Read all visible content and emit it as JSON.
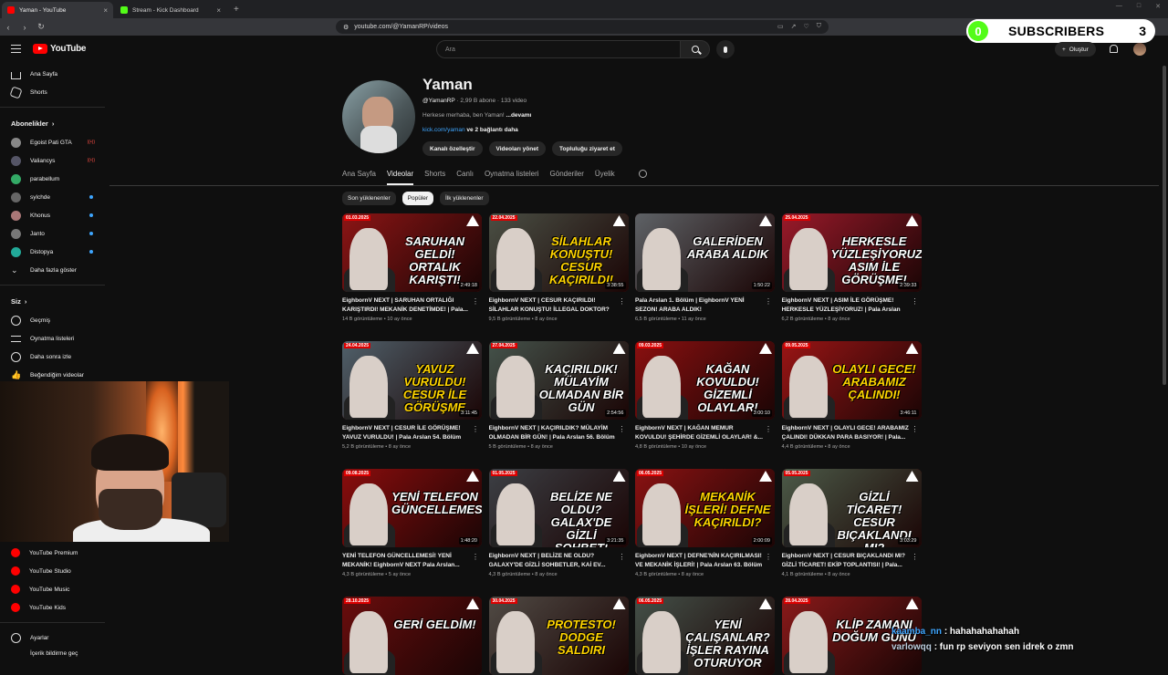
{
  "browser": {
    "tabs": [
      {
        "label": "Yaman - YouTube",
        "color": "#ff0000",
        "active": true
      },
      {
        "label": "Stream - Kick Dashboard",
        "color": "#53fc18",
        "active": false
      }
    ],
    "url": "youtube.com/@YamanRP/videos"
  },
  "youtube": {
    "logo": "YouTube",
    "search_placeholder": "Ara",
    "create_label": "Oluştur"
  },
  "overlay": {
    "left_count": "0",
    "label": "SUBSCRIBERS",
    "right_count": "3"
  },
  "sidebar": {
    "top": [
      {
        "label": "Ana Sayfa",
        "icon": "home-icon"
      },
      {
        "label": "Shorts",
        "icon": "shorts-icon"
      }
    ],
    "subs_header": "Abonelikler",
    "subs": [
      {
        "label": "Egoist Pati GTA",
        "color": "#888",
        "badge": "live"
      },
      {
        "label": "Valiancys",
        "color": "#556",
        "badge": "live"
      },
      {
        "label": "parabellum",
        "color": "#3a6",
        "badge": ""
      },
      {
        "label": "sylchde",
        "color": "#666",
        "badge": "dot"
      },
      {
        "label": "Khonus",
        "color": "#a77",
        "badge": "dot"
      },
      {
        "label": "Janto",
        "color": "#777",
        "badge": "dot"
      },
      {
        "label": "Distopya",
        "color": "#2a9",
        "badge": "dot"
      }
    ],
    "more": "Daha fazla göster",
    "you_header": "Siz",
    "you": [
      {
        "label": "Geçmiş",
        "icon": "history-icon"
      },
      {
        "label": "Oynatma listeleri",
        "icon": "playlist-icon"
      },
      {
        "label": "Daha sonra izle",
        "icon": "clock-icon"
      },
      {
        "label": "Beğendiğim videolar",
        "icon": "thumbs-up-icon"
      }
    ],
    "more_from": [
      {
        "label": "YouTube Premium"
      },
      {
        "label": "YouTube Studio"
      },
      {
        "label": "YouTube Music"
      },
      {
        "label": "YouTube Kids"
      }
    ],
    "settings": "Ayarlar",
    "report": "İçerik bildirme geç"
  },
  "channel": {
    "name": "Yaman",
    "handle": "@YamanRP",
    "subs": "2,99 B abone",
    "videos": "133 video",
    "desc": "Herkese merhaba, ben Yaman!",
    "more": "...devamı",
    "link": "kick.com/yaman",
    "link_more": "ve 2 bağlantı daha",
    "buttons": [
      "Kanalı özelleştir",
      "Videoları yönet",
      "Topluluğu ziyaret et"
    ],
    "tabs": [
      "Ana Sayfa",
      "Videolar",
      "Shorts",
      "Canlı",
      "Oynatma listeleri",
      "Gönderiler",
      "Üyelik"
    ],
    "active_tab": 1,
    "chips": [
      "Son yüklenenler",
      "Popüler",
      "İlk yüklenenler"
    ],
    "active_chip": 1
  },
  "videos": [
    {
      "date": "01.03.2025",
      "thumb": "SARUHAN GELDİ! ORTALIK KARIŞTI!",
      "duration": "2:49:18",
      "title": "EighbornV NEXT | SARUHAN ORTALIĞI KARIŞTIRDI! MEKANİK DENETİMDE! | Pala...",
      "views": "14 B görüntüleme",
      "age": "10 ay önce",
      "bg": "#8c1515"
    },
    {
      "date": "22.04.2025",
      "thumb": "SİLAHLAR KONUŞTU! CESUR KAÇIRILDI!",
      "duration": "3:38:55",
      "title": "EighbornV NEXT | CESUR KAÇIRILDI! SİLAHLAR KONUŞTU! İLLEGAL DOKTOR? |...",
      "views": "9,5 B görüntüleme",
      "age": "8 ay önce",
      "bg": "#4a4f44"
    },
    {
      "date": "",
      "thumb": "GALERİDEN ARABA ALDIK",
      "duration": "1:50:22",
      "title": "Pala Arslan 1. Bölüm | EighbornV YENİ SEZON! ARABA ALDIK!",
      "views": "6,5 B görüntüleme",
      "age": "11 ay önce",
      "bg": "#5e6266"
    },
    {
      "date": "25.04.2025",
      "thumb": "HERKESLE YÜZLEŞİYORUZ! ASIM İLE GÖRÜŞME!",
      "duration": "2:39:33",
      "title": "EighbornV NEXT | ASIM İLE GÖRÜŞME! HERKESLE YÜZLEŞİYORUZ! | Pala Arslan 5...",
      "views": "6,2 B görüntüleme",
      "age": "8 ay önce",
      "bg": "#9a1a2a"
    },
    {
      "date": "24.04.2025",
      "thumb": "YAVUZ VURULDU! CESUR İLE GÖRÜŞME",
      "duration": "3:11:45",
      "title": "EighbornV NEXT | CESUR İLE GÖRÜŞME! YAVUZ VURULDU! | Pala Arslan 54. Bölüm",
      "views": "5,2 B görüntüleme",
      "age": "8 ay önce",
      "bg": "#50606a"
    },
    {
      "date": "27.04.2025",
      "thumb": "KAÇIRILDIK! MÜLAYİM OLMADAN BİR GÜN",
      "duration": "2:54:56",
      "title": "EighbornV NEXT | KAÇIRILDIK? MÜLAYİM OLMADAN BİR GÜN! | Pala Arslan 56. Bölüm",
      "views": "5 B görüntüleme",
      "age": "8 ay önce",
      "bg": "#44524a"
    },
    {
      "date": "09.03.2025",
      "thumb": "KAĞAN KOVULDU! GİZEMLİ OLAYLAR!",
      "duration": "3:00:10",
      "title": "EighbornV NEXT | KAĞAN MEMUR KOVULDU! ŞEHİRDE GİZEMLİ OLAYLAR! &...",
      "views": "4,8 B görüntüleme",
      "age": "10 ay önce",
      "bg": "#8a1010"
    },
    {
      "date": "09.05.2025",
      "thumb": "OLAYLI GECE! ARABAMIZ ÇALINDI!",
      "duration": "3:46:11",
      "title": "EighbornV NEXT | OLAYLI GECE! ARABAMIZ ÇALINDI! DÜKKAN PARA BASIYOR! | Pala...",
      "views": "4,4 B görüntüleme",
      "age": "8 ay önce",
      "bg": "#9a1515"
    },
    {
      "date": "09.08.2025",
      "thumb": "YENİ TELEFON GÜNCELLEMESİ!",
      "duration": "1:48:20",
      "title": "YENİ TELEFON GÜNCELLEMESİ! YENİ MEKANİK! EighbornV NEXT Pala Arslan...",
      "views": "4,3 B görüntüleme",
      "age": "5 ay önce",
      "bg": "#8a0d0d"
    },
    {
      "date": "01.05.2025",
      "thumb": "BELİZE NE OLDU? GALAX'DE GİZLİ SOHBET!",
      "duration": "3:21:35",
      "title": "EighbornV NEXT | BELİZE NE OLDU? GALAXY'DE GİZLİ SOHBETLER, KAİ EV...",
      "views": "4,3 B görüntüleme",
      "age": "8 ay önce",
      "bg": "#3c3f44"
    },
    {
      "date": "06.05.2025",
      "thumb": "MEKANİK İŞLERİ! DEFNE KAÇIRILDI?",
      "duration": "2:00:09",
      "title": "EighbornV NEXT | DEFNE'NİN KAÇIRILMASI! VE MEKANİK İŞLERİ! | Pala Arslan 63. Bölüm",
      "views": "4,3 B görüntüleme",
      "age": "8 ay önce",
      "bg": "#8a1212"
    },
    {
      "date": "05.05.2025",
      "thumb": "GİZLİ TİCARET! CESUR BIÇAKLANDI MI?",
      "duration": "3:03:29",
      "title": "EighbornV NEXT | CESUR BIÇAKLANDI MI? GİZLİ TİCARET! EKİP TOPLANTISI! | Pala...",
      "views": "4,1 B görüntüleme",
      "age": "8 ay önce",
      "bg": "#4c5a48"
    },
    {
      "date": "28.10.2025",
      "thumb": "GERİ GELDİM!",
      "duration": "",
      "title": "",
      "views": "",
      "age": "",
      "bg": "#6a0d0d"
    },
    {
      "date": "30.04.2025",
      "thumb": "PROTESTO! DODGE SALDIRI",
      "duration": "",
      "title": "",
      "views": "",
      "age": "",
      "bg": "#504a44"
    },
    {
      "date": "06.05.2025",
      "thumb": "YENİ ÇALIŞANLAR? İŞLER RAYINA OTURUYOR",
      "duration": "",
      "title": "",
      "views": "",
      "age": "",
      "bg": "#445048"
    },
    {
      "date": "28.04.2025",
      "thumb": "KLİP ZAMANI DOĞUM GÜNÜ",
      "duration": "",
      "title": "",
      "views": "",
      "age": "",
      "bg": "#8a1a1a"
    }
  ],
  "chat": [
    {
      "user": "kaamba_nn",
      "msg": ": hahahahahahah"
    },
    {
      "user": "varlowqq",
      "msg": ": fun rp seviyon sen idrek o zmn"
    }
  ]
}
